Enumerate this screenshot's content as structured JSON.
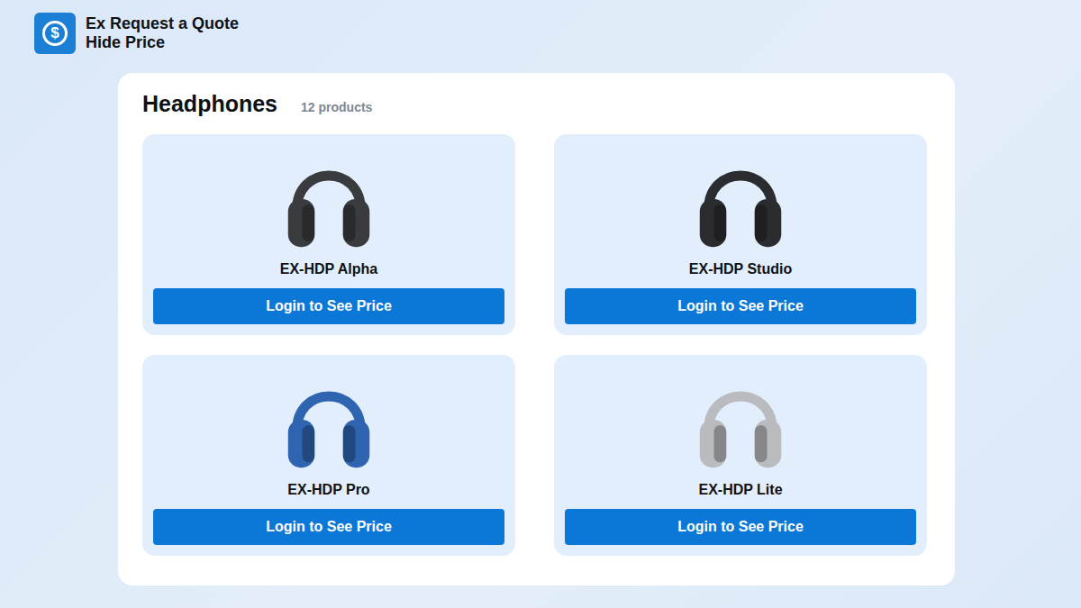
{
  "app": {
    "logo_glyph": "$",
    "title_lines": [
      "Ex Request a Quote",
      "Hide Price"
    ]
  },
  "section": {
    "title": "Headphones",
    "count": "12 products"
  },
  "products": [
    {
      "name": "EX-HDP Alpha",
      "button": "Login to See Price",
      "color": "#3a3b3e"
    },
    {
      "name": "EX-HDP Studio",
      "button": "Login to See Price",
      "color": "#2b2c2f"
    },
    {
      "name": "EX-HDP Pro",
      "button": "Login to See Price",
      "color": "#2f65b0"
    },
    {
      "name": "EX-HDP Lite",
      "button": "Login to See Price",
      "color": "#b9bbbe"
    }
  ]
}
